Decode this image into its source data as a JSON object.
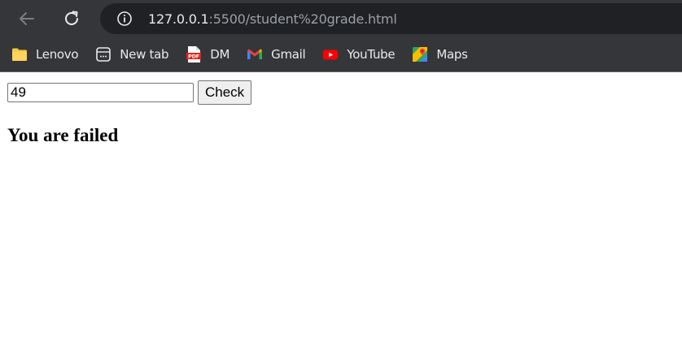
{
  "browser": {
    "url_host": "127.0.0.1",
    "url_path": ":5500/student%20grade.html",
    "bookmarks": [
      {
        "label": "Lenovo",
        "icon": "folder-icon"
      },
      {
        "label": "New tab",
        "icon": "new-tab-icon"
      },
      {
        "label": "DM",
        "icon": "pdf-icon"
      },
      {
        "label": "Gmail",
        "icon": "gmail-icon"
      },
      {
        "label": "YouTube",
        "icon": "youtube-icon"
      },
      {
        "label": "Maps",
        "icon": "maps-icon"
      }
    ]
  },
  "page": {
    "grade_value": "49",
    "check_label": "Check",
    "result_text": "You are failed"
  },
  "colors": {
    "chrome_bg": "#35363a",
    "omnibox_bg": "#202124",
    "text_light": "#e8eaed"
  }
}
